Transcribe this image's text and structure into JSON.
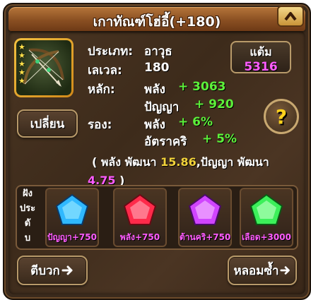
{
  "title": "เกาทัณฑ์โฮ่อี้(+180)",
  "item": {
    "stars": 5,
    "icon": "crossed-bows-icon"
  },
  "info": {
    "type_label": "ประเภท:",
    "type_value": "อาวุธ",
    "level_label": "เลเวล:",
    "level_value": "180",
    "main_label": "หลัก:",
    "main_stats": [
      {
        "name": "พลัง",
        "value": "+ 3063"
      },
      {
        "name": "ปัญญา",
        "value": "+ 920"
      }
    ],
    "sub_label": "รอง:",
    "sub_stats": [
      {
        "name": "พลัง",
        "value": "+ 6%"
      },
      {
        "name": "อัตราคริ",
        "value": "+ 5%"
      }
    ]
  },
  "growth": {
    "open": "( พลัง พัฒนา ",
    "str_value": "15.86",
    "mid": ",ปัญญา พัฒนา",
    "int_value": "4.75",
    "close": " )"
  },
  "score": {
    "label": "แต้ม",
    "value": "5316"
  },
  "change_button": "เปลี่ยน",
  "help_icon": "question-icon",
  "gems": {
    "slot_label": [
      "ฝัง",
      "ประ",
      "ดั",
      "บ"
    ],
    "items": [
      {
        "caption": "ปัญญา+750",
        "color": "#2fb8ff"
      },
      {
        "caption": "พลัง+750",
        "color": "#ff2a4a"
      },
      {
        "caption": "ต้านคริ+750",
        "color": "#d044ff"
      },
      {
        "caption": "เลือด+3000",
        "color": "#3cf05a"
      }
    ]
  },
  "forge_button": "ตีบวก",
  "smelt_button": "หลอมซ้ำ",
  "colors": {
    "accent_green": "#5cf03a",
    "accent_yellow": "#f2d23a",
    "accent_magenta": "#ff5cff"
  }
}
